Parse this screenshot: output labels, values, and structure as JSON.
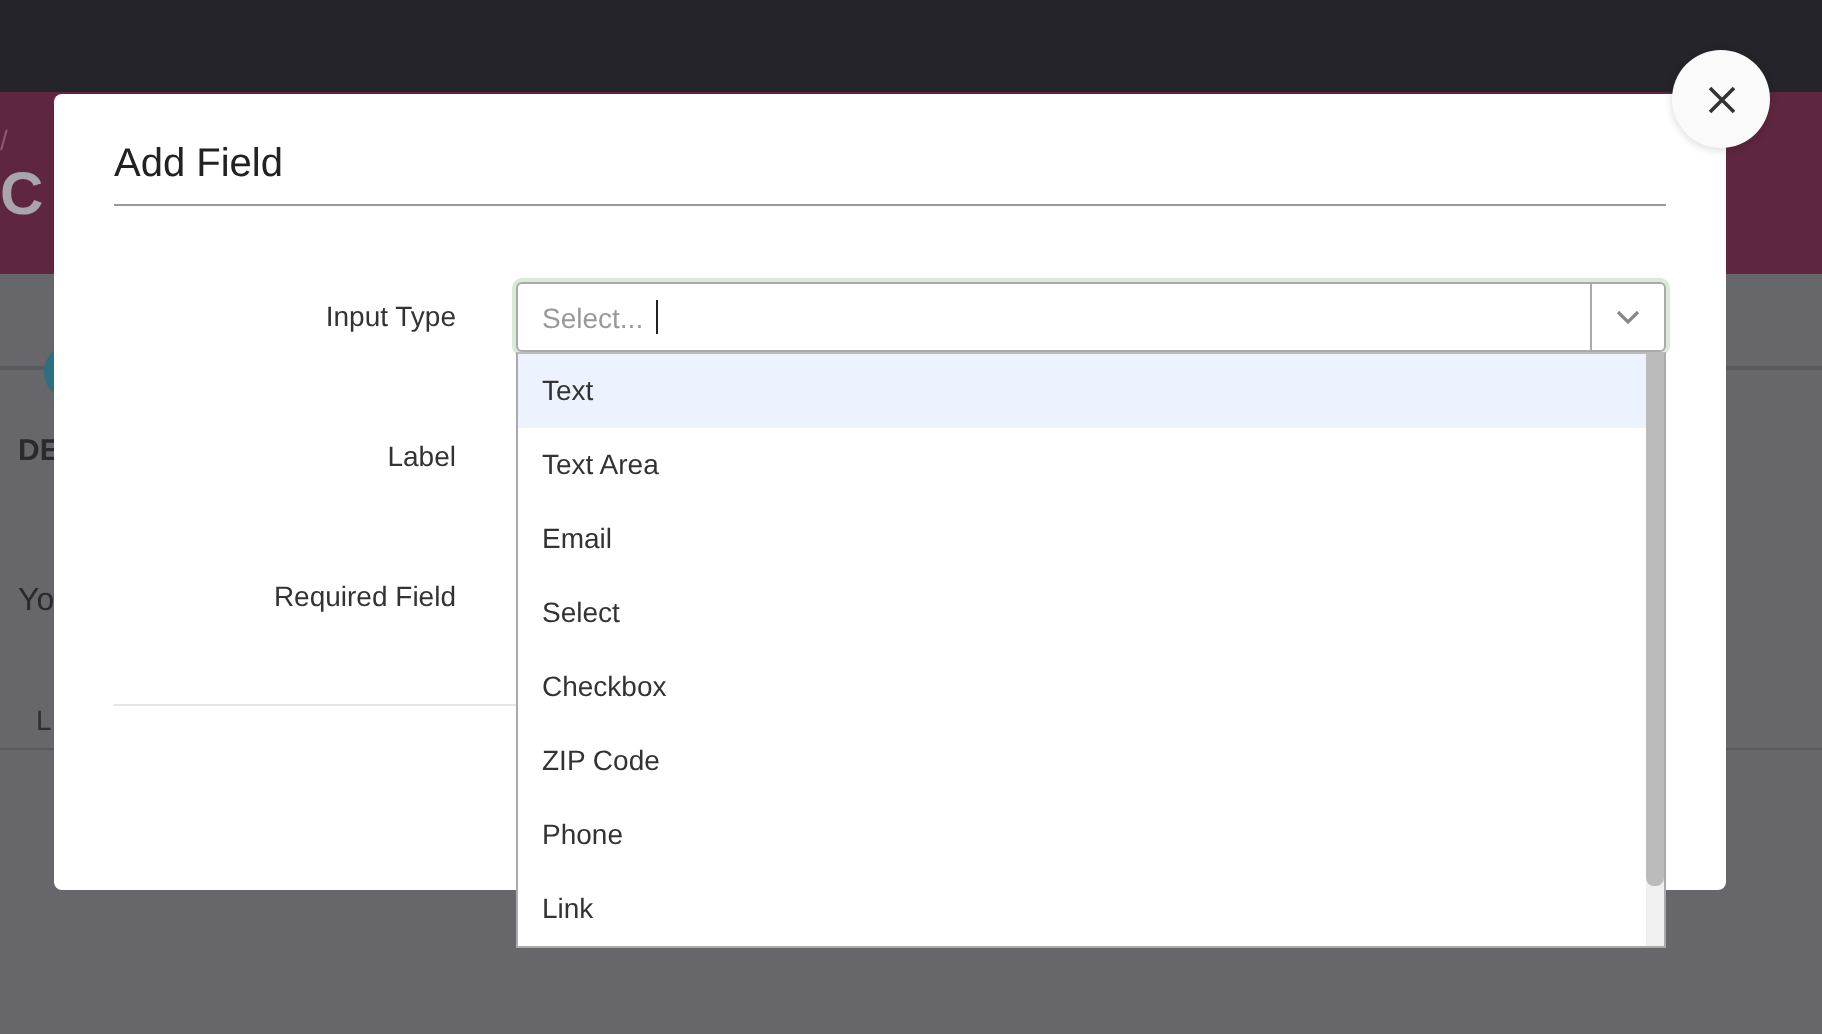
{
  "background_page": {
    "breadcrumb_separator": "/",
    "title": "C",
    "section_heading": "DE",
    "text": "Yo",
    "column_1": "L"
  },
  "dialog": {
    "title": "Add Field",
    "fields": [
      {
        "label": "Input Type",
        "kind": "select"
      },
      {
        "label": "Label",
        "kind": "covered"
      },
      {
        "label": "Required Field",
        "kind": "covered"
      }
    ],
    "input_type": {
      "placeholder": "Select...",
      "focused": true,
      "expanded": true,
      "options": [
        {
          "label": "Text",
          "selected": true
        },
        {
          "label": "Text Area",
          "selected": false
        },
        {
          "label": "Email",
          "selected": false
        },
        {
          "label": "Select",
          "selected": false
        },
        {
          "label": "Checkbox",
          "selected": false
        },
        {
          "label": "ZIP Code",
          "selected": false
        },
        {
          "label": "Phone",
          "selected": false
        },
        {
          "label": "Link",
          "selected": false
        }
      ]
    }
  }
}
